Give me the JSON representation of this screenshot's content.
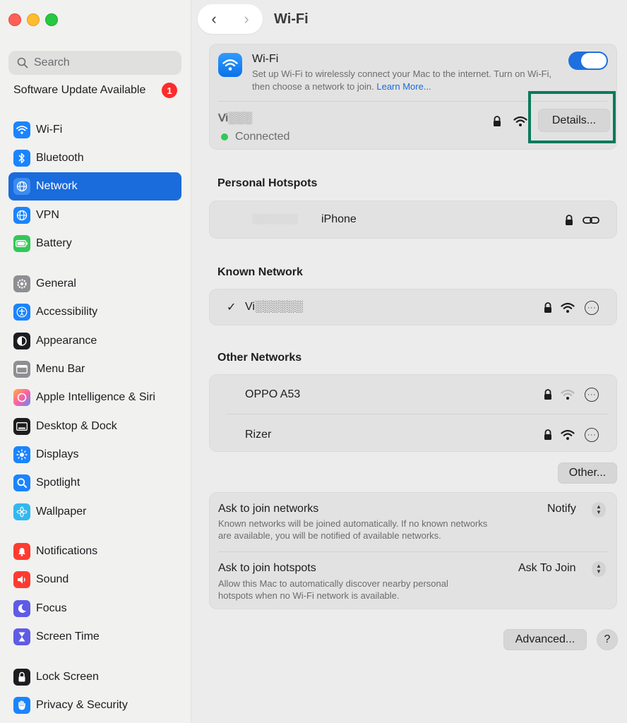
{
  "sidebar": {
    "search_placeholder": "Search",
    "update_label": "Software Update Available",
    "update_count": "1",
    "items": [
      {
        "label": "Wi-Fi",
        "icon": "wifi-icon",
        "color": "#1a84ff"
      },
      {
        "label": "Bluetooth",
        "icon": "bluetooth-icon",
        "color": "#1a84ff"
      },
      {
        "label": "Network",
        "icon": "globe-icon",
        "color": "#1a84ff"
      },
      {
        "label": "VPN",
        "icon": "vpn-globe-icon",
        "color": "#1a84ff"
      },
      {
        "label": "Battery",
        "icon": "battery-icon",
        "color": "#34c759"
      },
      {
        "label": "General",
        "icon": "gear-icon",
        "color": "#8e8e93"
      },
      {
        "label": "Accessibility",
        "icon": "accessibility-icon",
        "color": "#1a84ff"
      },
      {
        "label": "Appearance",
        "icon": "appearance-icon",
        "color": "#1d1d1f"
      },
      {
        "label": "Menu Bar",
        "icon": "menu-bar-icon",
        "color": "#8e8e93"
      },
      {
        "label": "Apple Intelligence & Siri",
        "icon": "siri-icon",
        "color": "#ff6fa8"
      },
      {
        "label": "Desktop & Dock",
        "icon": "dock-icon",
        "color": "#1d1d1f"
      },
      {
        "label": "Displays",
        "icon": "sun-icon",
        "color": "#1a84ff"
      },
      {
        "label": "Spotlight",
        "icon": "magnifier-icon",
        "color": "#1a84ff"
      },
      {
        "label": "Wallpaper",
        "icon": "flower-icon",
        "color": "#32b8f0"
      },
      {
        "label": "Notifications",
        "icon": "bell-icon",
        "color": "#ff3b30"
      },
      {
        "label": "Sound",
        "icon": "speaker-icon",
        "color": "#ff3b30"
      },
      {
        "label": "Focus",
        "icon": "moon-icon",
        "color": "#5e5ce6"
      },
      {
        "label": "Screen Time",
        "icon": "hourglass-icon",
        "color": "#5e5ce6"
      },
      {
        "label": "Lock Screen",
        "icon": "lock-icon",
        "color": "#1d1d1f"
      },
      {
        "label": "Privacy & Security",
        "icon": "hand-icon",
        "color": "#1a84ff"
      }
    ]
  },
  "header": {
    "title": "Wi-Fi"
  },
  "wifi": {
    "title": "Wi-Fi",
    "description": "Set up Wi-Fi to wirelessly connect your Mac to the internet. Turn on Wi-Fi, then choose a network to join.",
    "learn_more": "Learn More...",
    "enabled": true,
    "current_network": "Vi░░░",
    "status": "Connected",
    "details_button": "Details..."
  },
  "hotspots": {
    "title": "Personal Hotspots",
    "items": [
      {
        "owner": "░░░░░░░",
        "name": "iPhone"
      }
    ]
  },
  "known": {
    "title": "Known Network",
    "items": [
      {
        "name": "Vi░░░░░░"
      }
    ]
  },
  "other": {
    "title": "Other Networks",
    "items": [
      {
        "name": "OPPO A53"
      },
      {
        "name": "Rizer"
      }
    ],
    "other_button": "Other..."
  },
  "settings": {
    "ask_networks_label": "Ask to join networks",
    "ask_networks_value": "Notify",
    "ask_networks_desc_1": "Known networks will be joined automatically. If no known networks",
    "ask_networks_desc_2": "are available, you will be notified of available networks.",
    "ask_hotspots_label": "Ask to join hotspots",
    "ask_hotspots_value": "Ask To Join",
    "ask_hotspots_desc_1": "Allow this Mac to automatically discover nearby personal",
    "ask_hotspots_desc_2": "hotspots when no Wi-Fi network is available."
  },
  "footer": {
    "advanced_button": "Advanced...",
    "help_button": "?"
  }
}
